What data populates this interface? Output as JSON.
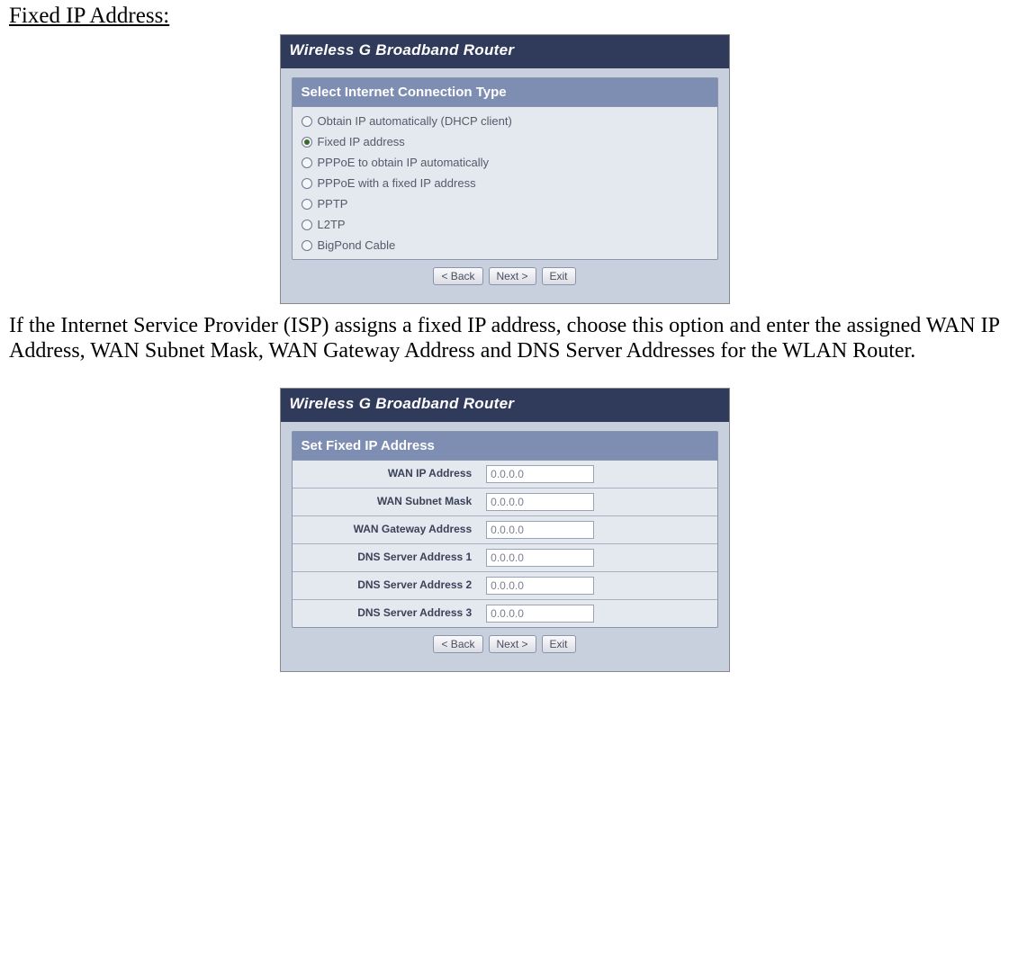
{
  "heading": "Fixed IP Address:",
  "panel1": {
    "title": "Wireless G Broadband Router",
    "section_header": "Select Internet Connection Type",
    "options": [
      {
        "label": "Obtain IP automatically (DHCP client)",
        "selected": false
      },
      {
        "label": "Fixed IP address",
        "selected": true
      },
      {
        "label": "PPPoE to obtain IP automatically",
        "selected": false
      },
      {
        "label": "PPPoE with a fixed IP address",
        "selected": false
      },
      {
        "label": "PPTP",
        "selected": false
      },
      {
        "label": "L2TP",
        "selected": false
      },
      {
        "label": "BigPond Cable",
        "selected": false
      }
    ],
    "buttons": {
      "back": "< Back",
      "next": "Next >",
      "exit": "Exit"
    }
  },
  "paragraph": "If the Internet Service Provider (ISP) assigns a fixed IP address, choose this option and enter the assigned WAN IP Address, WAN Subnet Mask, WAN Gateway Address and DNS Server Addresses for the WLAN Router.",
  "panel2": {
    "title": "Wireless G Broadband Router",
    "section_header": "Set Fixed IP Address",
    "fields": [
      {
        "label": "WAN IP Address",
        "value": "0.0.0.0"
      },
      {
        "label": "WAN Subnet Mask",
        "value": "0.0.0.0"
      },
      {
        "label": "WAN Gateway Address",
        "value": "0.0.0.0"
      },
      {
        "label": "DNS Server Address 1",
        "value": "0.0.0.0"
      },
      {
        "label": "DNS Server Address 2",
        "value": "0.0.0.0"
      },
      {
        "label": "DNS Server Address 3",
        "value": "0.0.0.0"
      }
    ],
    "buttons": {
      "back": "< Back",
      "next": "Next >",
      "exit": "Exit"
    }
  }
}
